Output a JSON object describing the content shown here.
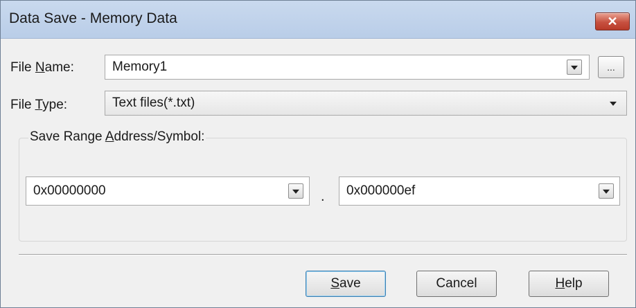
{
  "window": {
    "title": "Data Save - Memory Data",
    "close_glyph": "✕"
  },
  "file_name": {
    "label_pre": "File ",
    "label_mnemonic": "N",
    "label_post": "ame:",
    "value": "Memory1",
    "browse_label": "..."
  },
  "file_type": {
    "label_pre": "File ",
    "label_mnemonic": "T",
    "label_post": "ype:",
    "value": "Text files(*.txt)"
  },
  "save_range": {
    "label_pre": "Save Range ",
    "label_mnemonic": "A",
    "label_post": "ddress/Symbol:",
    "start": "0x00000000",
    "separator": ".",
    "end": "0x000000ef"
  },
  "buttons": {
    "save_mnemonic": "S",
    "save_rest": "ave",
    "cancel": "Cancel",
    "help_mnemonic": "H",
    "help_rest": "elp"
  },
  "icons": {
    "dropdown": "chevron-down-icon",
    "close": "close-icon"
  }
}
